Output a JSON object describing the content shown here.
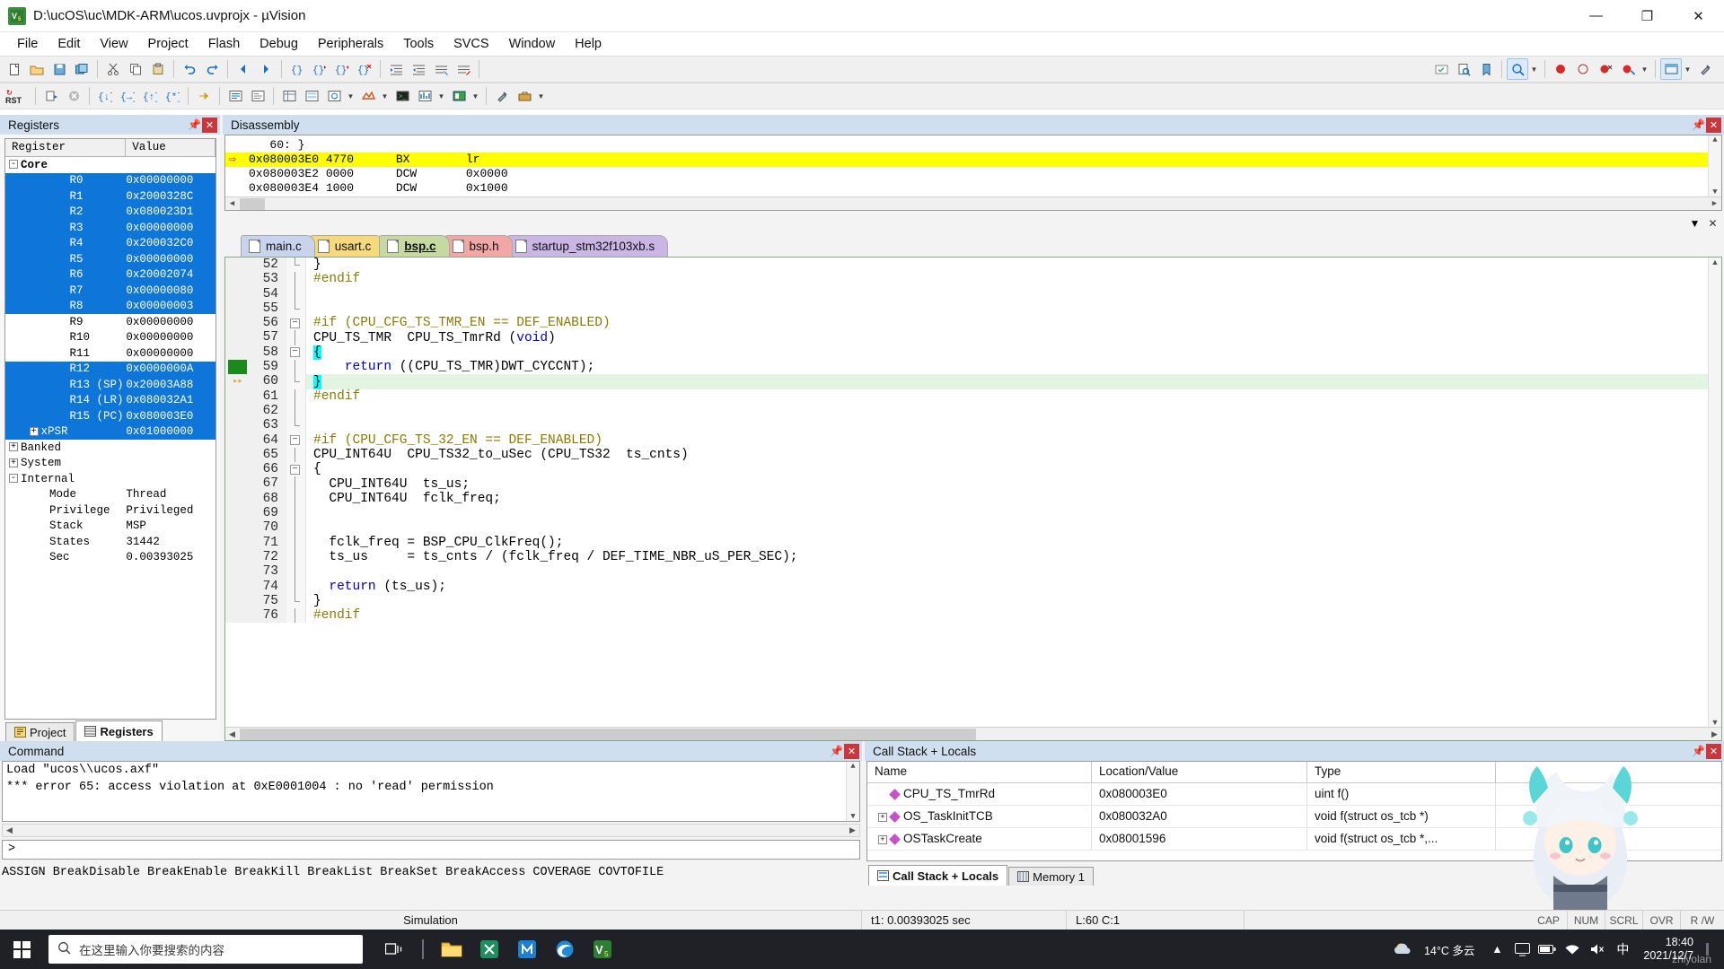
{
  "window": {
    "title": "D:\\ucOS\\uc\\MDK-ARM\\ucos.uvprojx - µVision",
    "app_icon": "uvision-icon",
    "minimize": "—",
    "maximize": "❐",
    "close": "✕"
  },
  "menubar": {
    "items": [
      "File",
      "Edit",
      "View",
      "Project",
      "Flash",
      "Debug",
      "Peripherals",
      "Tools",
      "SVCS",
      "Window",
      "Help"
    ]
  },
  "toolbar1": {
    "groups": [
      [
        "new-file-icon",
        "open-file-icon",
        "save-icon",
        "save-all-icon"
      ],
      [
        "cut-icon",
        "copy-icon",
        "paste-icon"
      ],
      [
        "undo-icon",
        "redo-icon"
      ],
      [
        "navigate-back-icon",
        "navigate-forward-icon"
      ],
      [
        "bookmark-toggle-icon",
        "bookmark-prev-icon",
        "bookmark-next-icon",
        "bookmark-clear-icon"
      ],
      [
        "indent-icon",
        "outdent-icon",
        "comment-icon",
        "uncomment-icon"
      ]
    ],
    "search_placeholder": "",
    "search_dropdown": "chevron-down-icon",
    "find_in_files_icon": "find-in-files-icon",
    "bookmark_icon": "bookmark-icon",
    "zoom_icon": "magnifier-icon",
    "breakpoint_icon": "breakpoint-icon",
    "breakpoint_disable_icon": "breakpoint-disable-icon",
    "breakpoint_kill_icon": "breakpoint-kill-icon",
    "target_icon": "target-options-icon",
    "window_icon": "window-icon",
    "config_icon": "configure-icon"
  },
  "toolbar2": {
    "reset_label": "RST",
    "icons": [
      "reset-icon",
      "run-icon",
      "stop-icon",
      "step-into-icon",
      "step-over-icon",
      "step-out-icon",
      "run-to-cursor-icon",
      "show-next-statement-icon",
      "disassembly-window-icon",
      "symbols-window-icon",
      "registers-window-icon",
      "call-stack-window-icon",
      "watch-window-icon",
      "memory-window-icon",
      "serial-window-icon",
      "analysis-window-icon",
      "trace-icon",
      "system-viewer-icon",
      "toolbox-icon"
    ]
  },
  "registers_pane": {
    "title": "Registers",
    "pin_icon": "pin-icon",
    "close_icon": "close-icon",
    "columns": [
      "Register",
      "Value"
    ],
    "tree": [
      {
        "name": "Core",
        "value": "",
        "level": 0,
        "expander": "-",
        "bold": true,
        "selected": false
      },
      {
        "name": "R0",
        "value": "0x00000000",
        "level": 2,
        "selected": true
      },
      {
        "name": "R1",
        "value": "0x2000328C",
        "level": 2,
        "selected": true
      },
      {
        "name": "R2",
        "value": "0x080023D1",
        "level": 2,
        "selected": true
      },
      {
        "name": "R3",
        "value": "0x00000000",
        "level": 2,
        "selected": true
      },
      {
        "name": "R4",
        "value": "0x200032C0",
        "level": 2,
        "selected": true
      },
      {
        "name": "R5",
        "value": "0x00000000",
        "level": 2,
        "selected": true
      },
      {
        "name": "R6",
        "value": "0x20002074",
        "level": 2,
        "selected": true
      },
      {
        "name": "R7",
        "value": "0x00000080",
        "level": 2,
        "selected": true
      },
      {
        "name": "R8",
        "value": "0x00000003",
        "level": 2,
        "selected": true
      },
      {
        "name": "R9",
        "value": "0x00000000",
        "level": 2,
        "selected": false
      },
      {
        "name": "R10",
        "value": "0x00000000",
        "level": 2,
        "selected": false
      },
      {
        "name": "R11",
        "value": "0x00000000",
        "level": 2,
        "selected": false
      },
      {
        "name": "R12",
        "value": "0x0000000A",
        "level": 2,
        "selected": true
      },
      {
        "name": "R13 (SP)",
        "value": "0x20003A88",
        "level": 2,
        "selected": true
      },
      {
        "name": "R14 (LR)",
        "value": "0x080032A1",
        "level": 2,
        "selected": true
      },
      {
        "name": "R15 (PC)",
        "value": "0x080003E0",
        "level": 2,
        "selected": true
      },
      {
        "name": "xPSR",
        "value": "0x01000000",
        "level": 1,
        "expander": "+",
        "selected": true
      },
      {
        "name": "Banked",
        "value": "",
        "level": 0,
        "expander": "+",
        "bold": false,
        "selected": false
      },
      {
        "name": "System",
        "value": "",
        "level": 0,
        "expander": "+",
        "bold": false,
        "selected": false
      },
      {
        "name": "Internal",
        "value": "",
        "level": 0,
        "expander": "-",
        "bold": false,
        "selected": false
      },
      {
        "name": "Mode",
        "value": "Thread",
        "level": 1,
        "selected": false
      },
      {
        "name": "Privilege",
        "value": "Privileged",
        "level": 1,
        "selected": false
      },
      {
        "name": "Stack",
        "value": "MSP",
        "level": 1,
        "selected": false
      },
      {
        "name": "States",
        "value": "31442",
        "level": 1,
        "selected": false
      },
      {
        "name": "Sec",
        "value": "0.00393025",
        "level": 1,
        "selected": false
      }
    ],
    "bottom_tabs": [
      {
        "label": "Project",
        "icon": "project-icon",
        "active": false
      },
      {
        "label": "Registers",
        "icon": "registers-icon",
        "active": true
      }
    ]
  },
  "disassembly_pane": {
    "title": "Disassembly",
    "pin_icon": "pin-icon",
    "close_icon": "close-icon",
    "lines": [
      {
        "text": "   60: }",
        "highlight": false,
        "marker": false
      },
      {
        "text": "0x080003E0 4770      BX        lr",
        "highlight": true,
        "marker": true
      },
      {
        "text": "0x080003E2 0000      DCW       0x0000",
        "highlight": false,
        "marker": false
      },
      {
        "text": "0x080003E4 1000      DCW       0x1000",
        "highlight": false,
        "marker": false
      }
    ],
    "scroll_left_icon": "chevron-left-icon",
    "scroll_right_icon": "chevron-right-icon"
  },
  "editor_pane": {
    "window_menu_icon": "chevron-down-icon",
    "close_icon": "close-icon",
    "tabs": [
      {
        "label": "main.c",
        "color": "#c8d4ee",
        "active": false
      },
      {
        "label": "usart.c",
        "color": "#f6d97a",
        "active": false
      },
      {
        "label": "bsp.c",
        "color": "#c6d9a0",
        "active": true
      },
      {
        "label": "bsp.h",
        "color": "#f2a7a7",
        "active": false
      },
      {
        "label": "startup_stm32f103xb.s",
        "color": "#c9b6e4",
        "active": false
      }
    ],
    "lines": [
      {
        "n": 52,
        "fold": "end",
        "indent": 0,
        "text": "}",
        "highlight": false,
        "marker": "none"
      },
      {
        "n": 53,
        "fold": "line",
        "indent": 0,
        "text": "#endif",
        "style": "pp",
        "highlight": false,
        "marker": "none"
      },
      {
        "n": 54,
        "fold": "line",
        "indent": 0,
        "text": "",
        "highlight": false,
        "marker": "none"
      },
      {
        "n": 55,
        "fold": "tail",
        "indent": 0,
        "text": "",
        "highlight": false,
        "marker": "none"
      },
      {
        "n": 56,
        "fold": "minus",
        "indent": 0,
        "text": "#if (CPU_CFG_TS_TMR_EN == DEF_ENABLED)",
        "style": "pp",
        "highlight": false,
        "marker": "none"
      },
      {
        "n": 57,
        "fold": "line",
        "indent": 0,
        "text": "CPU_TS_TMR  CPU_TS_TmrRd (void)",
        "highlight": false,
        "marker": "none"
      },
      {
        "n": 58,
        "fold": "minus",
        "indent": 0,
        "text": "{",
        "highlight": false,
        "marker": "none"
      },
      {
        "n": 59,
        "fold": "line",
        "indent": 0,
        "text": "    return ((CPU_TS_TMR)DWT_CYCCNT);",
        "highlight": false,
        "marker": "green"
      },
      {
        "n": 60,
        "fold": "end",
        "indent": 0,
        "text": "}",
        "highlight": true,
        "marker": "arrow"
      },
      {
        "n": 61,
        "fold": "line",
        "indent": 0,
        "text": "#endif",
        "style": "pp",
        "highlight": false,
        "marker": "none"
      },
      {
        "n": 62,
        "fold": "line",
        "indent": 0,
        "text": "",
        "highlight": false,
        "marker": "none"
      },
      {
        "n": 63,
        "fold": "tail",
        "indent": 0,
        "text": "",
        "highlight": false,
        "marker": "none"
      },
      {
        "n": 64,
        "fold": "minus",
        "indent": 0,
        "text": "#if (CPU_CFG_TS_32_EN == DEF_ENABLED)",
        "style": "pp",
        "highlight": false,
        "marker": "none"
      },
      {
        "n": 65,
        "fold": "line",
        "indent": 0,
        "text": "CPU_INT64U  CPU_TS32_to_uSec (CPU_TS32  ts_cnts)",
        "highlight": false,
        "marker": "none"
      },
      {
        "n": 66,
        "fold": "minus",
        "indent": 0,
        "text": "{",
        "highlight": false,
        "marker": "none"
      },
      {
        "n": 67,
        "fold": "line",
        "indent": 0,
        "text": "  CPU_INT64U  ts_us;",
        "highlight": false,
        "marker": "none"
      },
      {
        "n": 68,
        "fold": "line",
        "indent": 0,
        "text": "  CPU_INT64U  fclk_freq;",
        "highlight": false,
        "marker": "none"
      },
      {
        "n": 69,
        "fold": "line",
        "indent": 0,
        "text": "",
        "highlight": false,
        "marker": "none"
      },
      {
        "n": 70,
        "fold": "line",
        "indent": 0,
        "text": "",
        "highlight": false,
        "marker": "none"
      },
      {
        "n": 71,
        "fold": "line",
        "indent": 0,
        "text": "  fclk_freq = BSP_CPU_ClkFreq();",
        "highlight": false,
        "marker": "none"
      },
      {
        "n": 72,
        "fold": "line",
        "indent": 0,
        "text": "  ts_us     = ts_cnts / (fclk_freq / DEF_TIME_NBR_uS_PER_SEC);",
        "highlight": false,
        "marker": "none"
      },
      {
        "n": 73,
        "fold": "line",
        "indent": 0,
        "text": "",
        "highlight": false,
        "marker": "none"
      },
      {
        "n": 74,
        "fold": "line",
        "indent": 0,
        "text": "  return (ts_us);",
        "highlight": false,
        "marker": "none"
      },
      {
        "n": 75,
        "fold": "end",
        "indent": 0,
        "text": "}",
        "highlight": false,
        "marker": "none"
      },
      {
        "n": 76,
        "fold": "line",
        "indent": 0,
        "text": "#endif",
        "style": "pp",
        "highlight": false,
        "marker": "none"
      }
    ]
  },
  "command_pane": {
    "title": "Command",
    "pin_icon": "pin-icon",
    "close_icon": "close-icon",
    "output": [
      "Load \"ucos\\\\ucos.axf\"",
      "*** error 65: access violation at 0xE0001004 : no 'read' permission"
    ],
    "prompt": ">",
    "input_value": "",
    "hints": "ASSIGN BreakDisable BreakEnable BreakKill BreakList BreakSet BreakAccess COVERAGE COVTOFILE"
  },
  "callstack_pane": {
    "title": "Call Stack + Locals",
    "pin_icon": "pin-icon",
    "close_icon": "close-icon",
    "columns": [
      "Name",
      "Location/Value",
      "Type"
    ],
    "rows": [
      {
        "expander": "",
        "name": "CPU_TS_TmrRd",
        "location": "0x080003E0",
        "type": "uint f()"
      },
      {
        "expander": "+",
        "name": "OS_TaskInitTCB",
        "location": "0x080032A0",
        "type": "void f(struct os_tcb *)"
      },
      {
        "expander": "+",
        "name": "OSTaskCreate",
        "location": "0x08001596",
        "type": "void f(struct os_tcb *,..."
      }
    ],
    "tabs": [
      {
        "label": "Call Stack + Locals",
        "icon": "call-stack-icon",
        "active": true
      },
      {
        "label": "Memory 1",
        "icon": "memory-icon",
        "active": false
      }
    ]
  },
  "statusbar": {
    "simulation": "Simulation",
    "time": "t1: 0.00393025 sec",
    "position": "L:60 C:1",
    "flags": [
      "CAP",
      "NUM",
      "SCRL",
      "OVR",
      "R /W"
    ]
  },
  "taskbar": {
    "start_icon": "windows-start-icon",
    "search_icon": "search-icon",
    "search_placeholder": "在这里输入你要搜索的内容",
    "task_view_icon": "task-view-icon",
    "pinned": [
      "file-explorer-icon",
      "app-x-icon",
      "app-m-icon",
      "edge-icon",
      "uvision-icon"
    ],
    "weather_icon": "cloud-icon",
    "weather": "14°C  多云",
    "tray_icons": [
      "chevron-up-icon",
      "screen-icon",
      "battery-icon",
      "network-icon",
      "volume-icon",
      "ime-icon"
    ],
    "ime": "中",
    "time": "18:40",
    "date": "2021/12/7",
    "watermark": "zhiyolan"
  }
}
